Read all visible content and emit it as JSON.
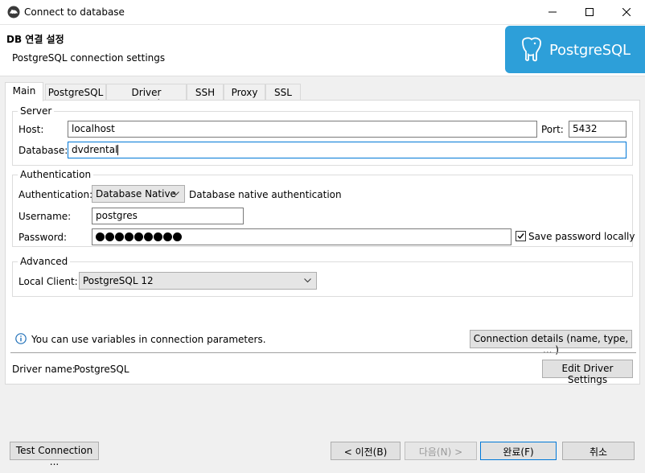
{
  "window": {
    "title": "Connect to database",
    "minimize_icon": "minimize-icon",
    "maximize_icon": "maximize-icon",
    "close_icon": "close-icon"
  },
  "header": {
    "title": "DB 연결 설정",
    "subtitle": "PostgreSQL connection settings",
    "logo_text": "PostgreSQL",
    "logo_color": "#2d9fd9"
  },
  "tabs": [
    {
      "label": "Main",
      "active": true
    },
    {
      "label": "PostgreSQL",
      "active": false
    },
    {
      "label": "Driver properties",
      "active": false
    },
    {
      "label": "SSH",
      "active": false
    },
    {
      "label": "Proxy",
      "active": false
    },
    {
      "label": "SSL",
      "active": false
    }
  ],
  "server": {
    "group_title": "Server",
    "host_label": "Host:",
    "host_value": "localhost",
    "port_label": "Port:",
    "port_value": "5432",
    "database_label": "Database:",
    "database_value": "dvdrental"
  },
  "authentication": {
    "group_title": "Authentication",
    "auth_label": "Authentication:",
    "auth_value": "Database Native",
    "auth_desc": "Database native authentication",
    "username_label": "Username:",
    "username_value": "postgres",
    "password_label": "Password:",
    "password_length": 9,
    "save_password_label": "Save password locally",
    "save_password_checked": true
  },
  "advanced": {
    "group_title": "Advanced",
    "local_client_label": "Local Client:",
    "local_client_value": "PostgreSQL 12"
  },
  "info": {
    "text": "You can use variables in connection parameters.",
    "connection_details_button": "Connection details (name, type, ... )"
  },
  "driver": {
    "name_label": "Driver name:",
    "name_value": "PostgreSQL",
    "edit_button": "Edit Driver Settings"
  },
  "footer": {
    "test_button": "Test Connection ...",
    "back_button": "< 이전(B)",
    "next_button": "다음(N) >",
    "finish_button": "완료(F)",
    "cancel_button": "취소"
  }
}
